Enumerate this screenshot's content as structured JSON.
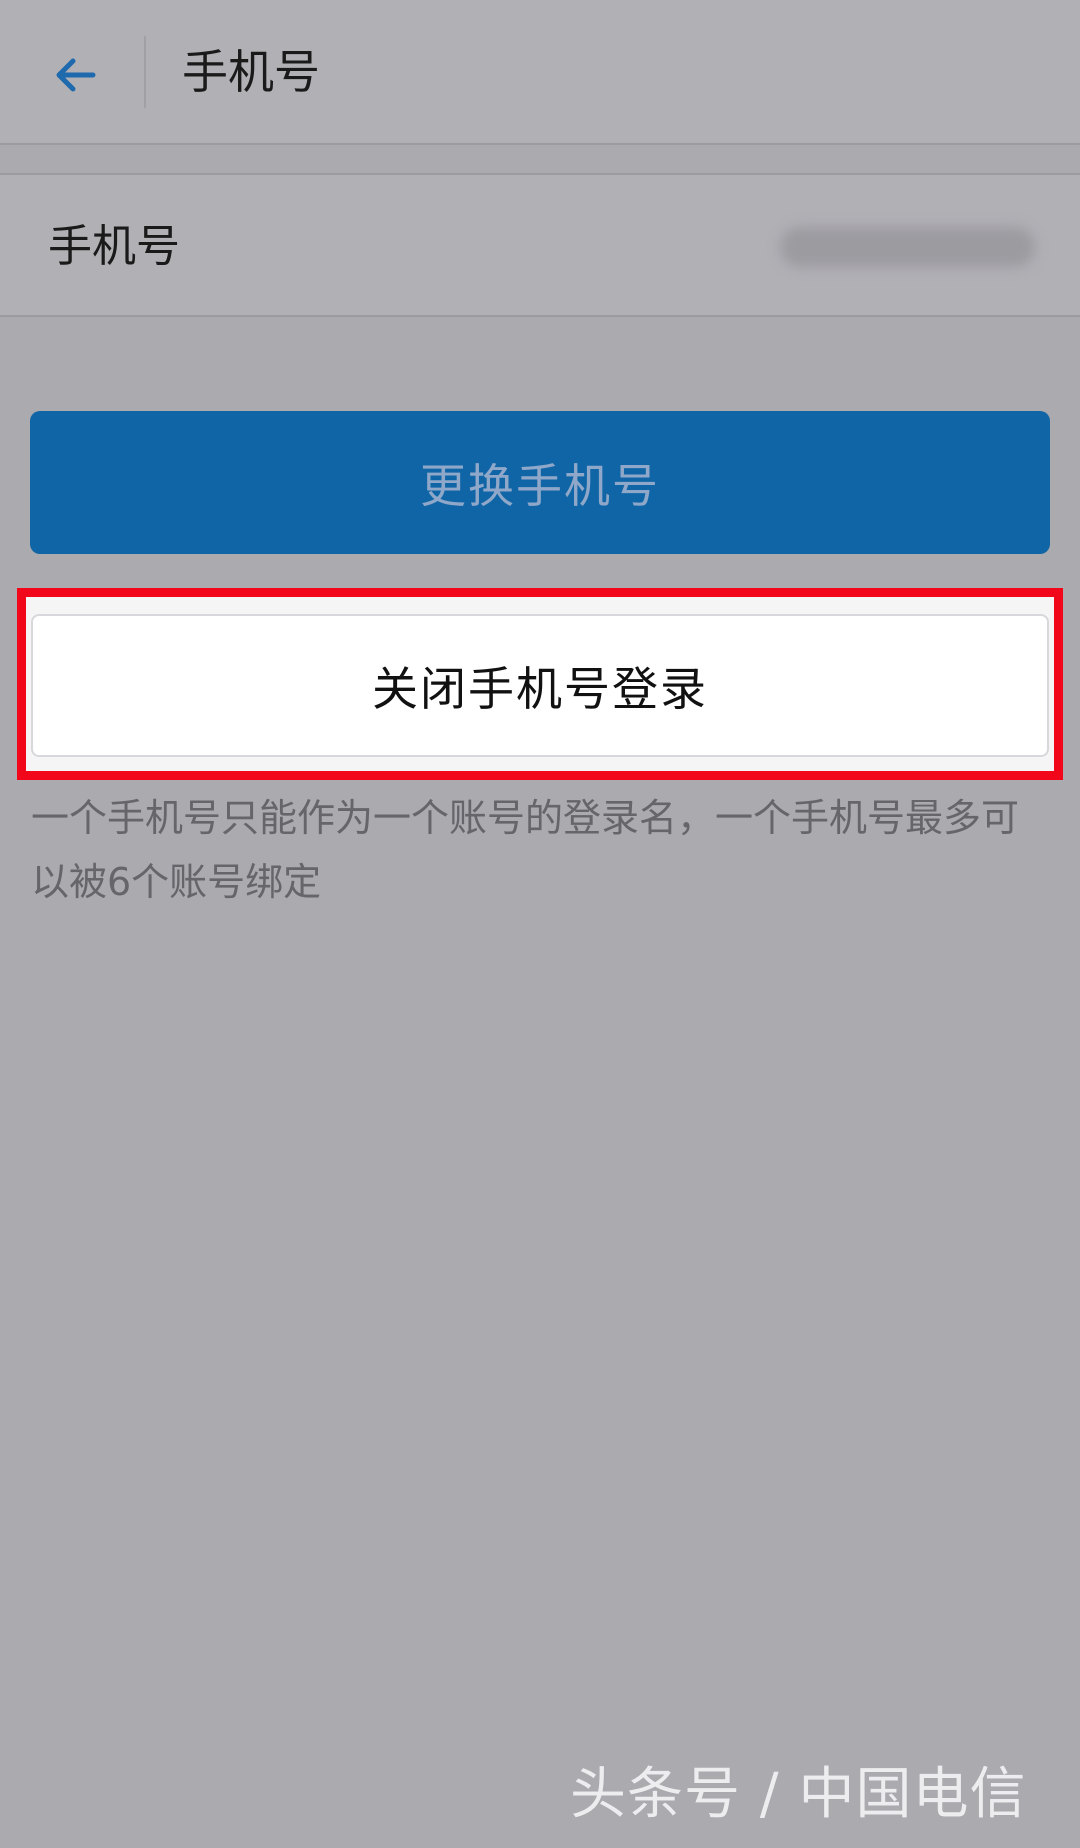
{
  "header": {
    "title": "手机号",
    "back_icon": "back-arrow-icon"
  },
  "phone_row": {
    "label": "手机号",
    "value_state": "blurred"
  },
  "actions": {
    "change_phone_label": "更换手机号",
    "close_phone_login_label": "关闭手机号登录"
  },
  "hint": {
    "text": "一个手机号只能作为一个账号的登录名，一个手机号最多可以被6个账号绑定"
  },
  "watermark": {
    "text": "头条号 / 中国电信"
  },
  "colors": {
    "accent_blue": "#0f65a6",
    "highlight_red": "#f2071a",
    "overlay_gray": "#abaaaf"
  }
}
